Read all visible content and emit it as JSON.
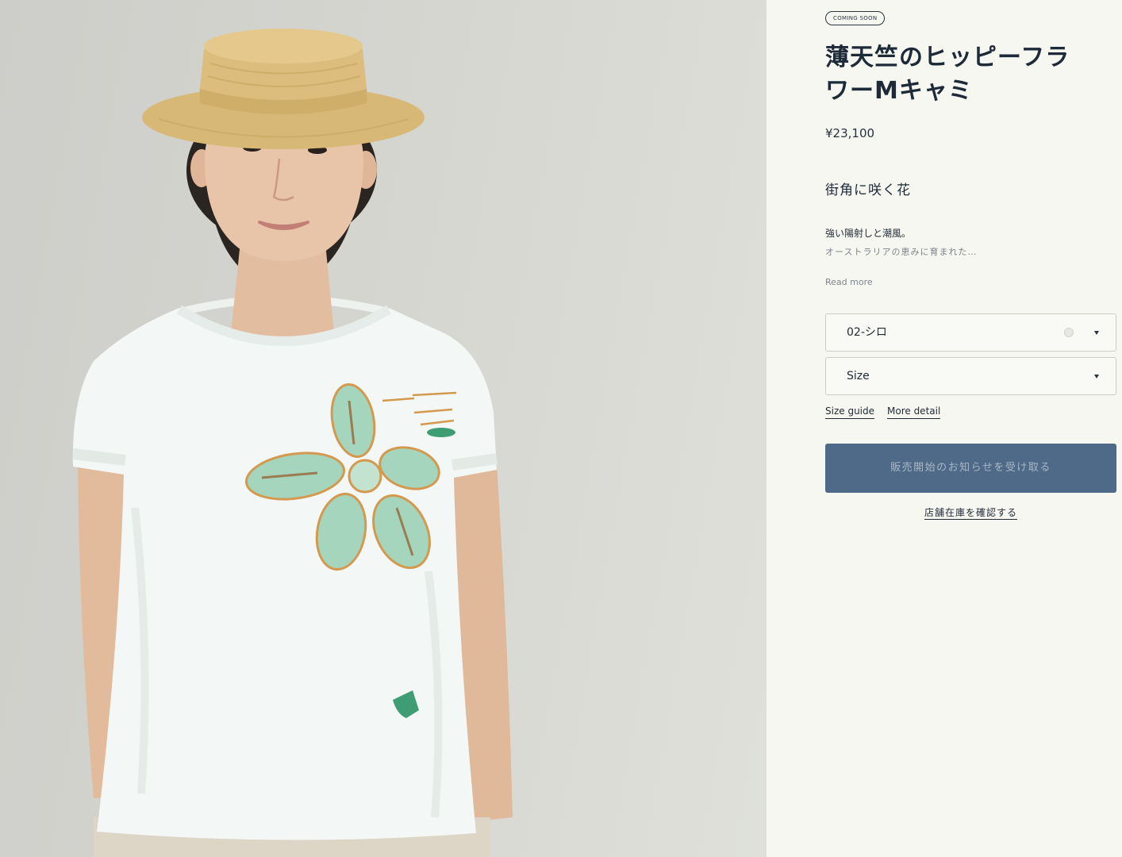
{
  "product": {
    "badge": "COMING SOON",
    "title": "薄天竺のヒッピーフラワーMキャミ",
    "price": "¥23,100",
    "tagline": "街角に咲く花",
    "description": {
      "lead": "強い陽射しと潮風。",
      "excerpt": "オーストラリアの恵みに育まれた…",
      "read_more": "Read more"
    },
    "variant_selectors": [
      {
        "value": "02-シロ"
      },
      {
        "value": "Size"
      }
    ],
    "links": {
      "size_guide": "Size guide",
      "more_detail": "More detail"
    },
    "notify_button_label": "販売開始のお知らせを受け取る",
    "store_stock_link": "店舗在庫を確認する"
  },
  "icons": {
    "swatch": "circle-swatch-icon",
    "dropdown": "chevron-down-icon"
  },
  "colors": {
    "panel_background": "#f7f7f2",
    "button_background": "#4f6a88",
    "button_text": "#a9b7c6",
    "text": "#1d2a38"
  }
}
